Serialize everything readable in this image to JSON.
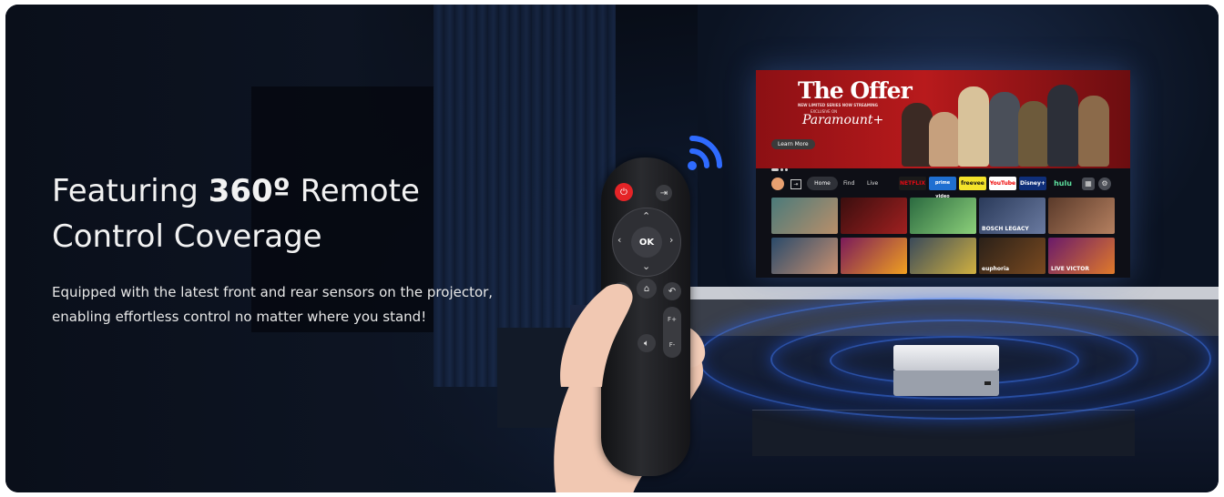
{
  "headline": {
    "prefix": "Featuring",
    "emphasis": "360º",
    "suffix": "Remote",
    "line2": "Control Coverage"
  },
  "body": {
    "line1": "Equipped with the latest front and rear sensors on the projector,",
    "line2": "enabling effortless control no matter where you stand!"
  },
  "screen": {
    "hero": {
      "title": "The Offer",
      "subtitle": "NEW LIMITED SERIES NOW STREAMING",
      "exclusive": "EXCLUSIVE ON",
      "brand": "Paramount+",
      "button": "Learn More"
    },
    "nav": {
      "home": "Home",
      "find": "Find",
      "live": "Live",
      "apps": [
        "NETFLIX",
        "prime video",
        "freevee",
        "YouTube",
        "Disney+",
        "hulu"
      ]
    },
    "tiles": [
      "",
      "",
      "",
      "BOSCH LEGACY",
      "",
      "",
      "",
      "",
      "",
      "euphoria",
      "LIVE VICTOR"
    ]
  },
  "remote": {
    "ok_label": "OK",
    "f_plus": "F+",
    "f_minus": "F-"
  },
  "colors": {
    "accent_red": "#e52427",
    "signal_blue": "#2f6bff"
  },
  "icons": [
    "power-icon",
    "input-icon",
    "menu-icon",
    "home-icon",
    "back-icon",
    "mute-icon",
    "wifi-signal-icon",
    "settings-icon"
  ]
}
